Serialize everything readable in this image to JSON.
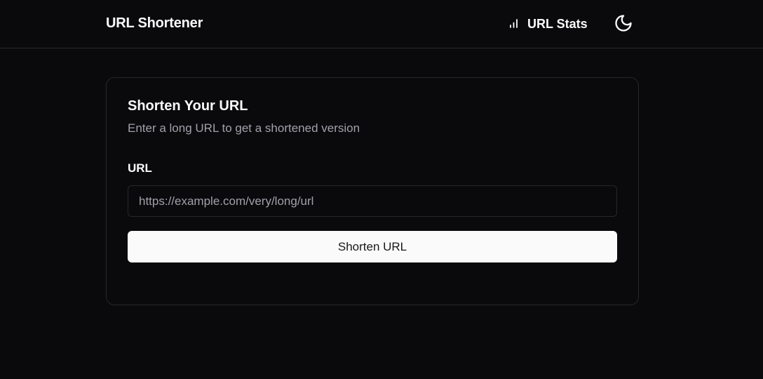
{
  "header": {
    "brand": "URL Shortener",
    "stats_link": "URL Stats",
    "stats_icon": "bar-chart-icon",
    "theme_icon": "moon-icon"
  },
  "card": {
    "title": "Shorten Your URL",
    "subtitle": "Enter a long URL to get a shortened version",
    "field_label": "URL",
    "input_value": "",
    "input_placeholder": "https://example.com/very/long/url",
    "submit_label": "Shorten URL"
  },
  "colors": {
    "background": "#0a0a0c",
    "border": "#27272a",
    "text": "#fafafa",
    "muted_text": "#a1a1aa",
    "button_bg": "#fafafa",
    "button_text": "#18181b"
  }
}
